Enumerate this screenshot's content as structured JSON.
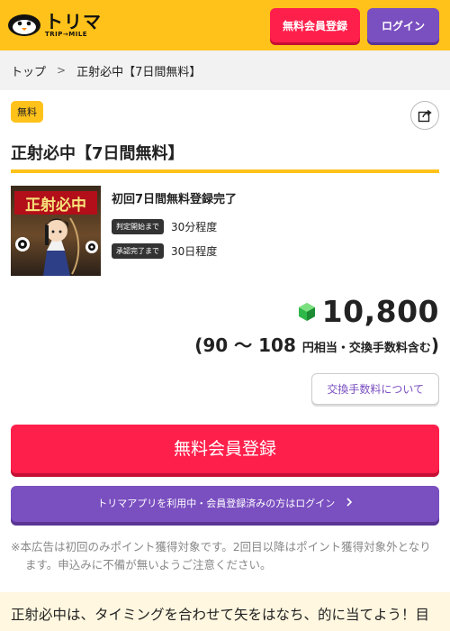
{
  "header": {
    "logo_text": "トリマ",
    "logo_sub": "TRIP→MILE",
    "register_label": "無料会員登録",
    "login_label": "ログイン"
  },
  "breadcrumb": {
    "home": "トップ",
    "separator": ">",
    "current": "正射必中【7日間無料】"
  },
  "offer": {
    "badge": "無料",
    "title": "正射必中【7日間無料】",
    "condition": "初回7日間無料登録完了",
    "meta": [
      {
        "tag": "判定開始まで",
        "value": "30分程度"
      },
      {
        "tag": "承認完了まで",
        "value": "30日程度"
      }
    ],
    "points": "10,800",
    "yen_open": "(",
    "yen_range": "90 〜 108",
    "yen_suffix": "円相当・交換手数料含む",
    "yen_close": ")",
    "fee_button": "交換手数料について",
    "register_button": "無料会員登録",
    "login_bar": "トリマアプリを利用中・会員登録済みの方はログイン",
    "notice": "※本広告は初回のみポイント獲得対象です。2回目以降はポイント獲得対象外となります。申込みに不備が無いようご注意ください。"
  },
  "description": {
    "text": "正射必中は、タイミングを合わせて矢をはなち、的に当てよう！目指せ最高点！"
  },
  "colors": {
    "brand_yellow": "#ffc21a",
    "register_red": "#ff1f4b",
    "login_purple": "#7a4fc0"
  },
  "icons": {
    "share": "share-icon",
    "chevron": "chevron-right-icon",
    "gem": "gem-icon"
  }
}
